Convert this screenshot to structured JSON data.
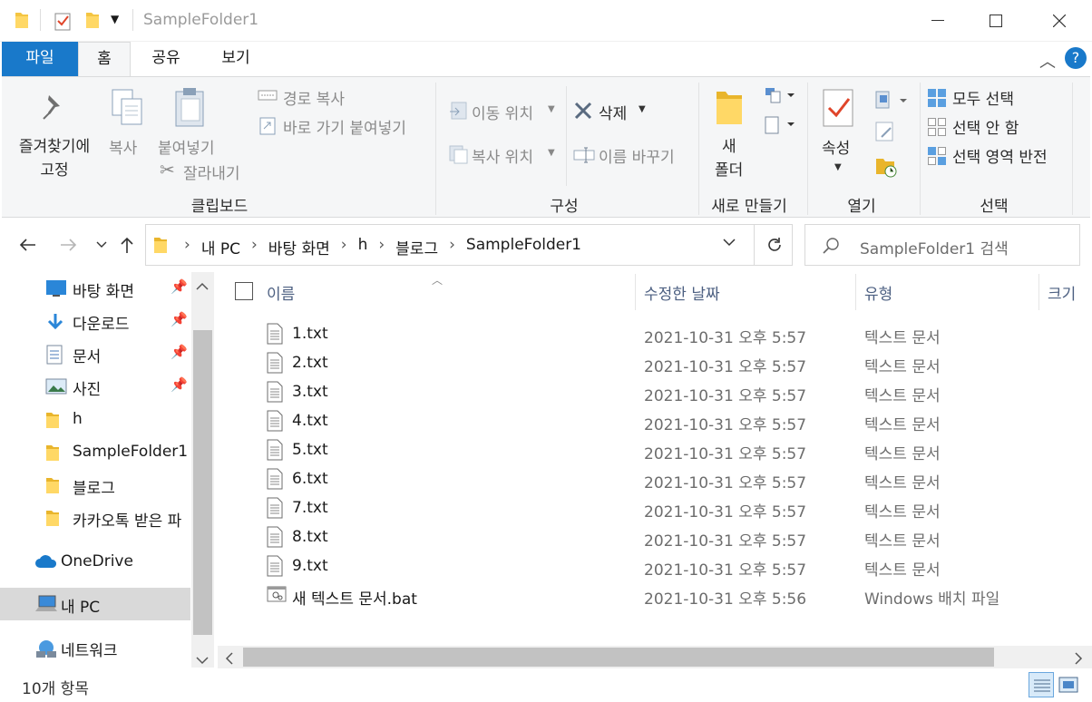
{
  "window": {
    "title": "SampleFolder1"
  },
  "tabs": {
    "file": "파일",
    "home": "홈",
    "share": "공유",
    "view": "보기"
  },
  "ribbon": {
    "clipboard": {
      "pin_quick_access": "즐겨찾기에 고정",
      "copy": "복사",
      "paste": "붙여넣기",
      "copy_path": "경로 복사",
      "paste_shortcut": "바로 가기 붙여넣기",
      "cut": "잘라내기",
      "group_label": "클립보드"
    },
    "organize": {
      "move_to": "이동 위치",
      "copy_to": "복사 위치",
      "delete": "삭제",
      "rename": "이름 바꾸기",
      "group_label": "구성"
    },
    "new": {
      "new_folder_line1": "새",
      "new_folder_line2": "폴더",
      "group_label": "새로 만들기"
    },
    "open": {
      "properties": "속성",
      "group_label": "열기"
    },
    "select": {
      "select_all": "모두 선택",
      "select_none": "선택 안 함",
      "invert_selection": "선택 영역 반전",
      "group_label": "선택"
    }
  },
  "address": {
    "crumbs": [
      "내 PC",
      "바탕 화면",
      "h",
      "블로그",
      "SampleFolder1"
    ],
    "search_placeholder": "SampleFolder1 검색"
  },
  "nav_pane": {
    "quick_access": [
      {
        "label": "바탕 화면",
        "icon": "desktop-icon",
        "pinned": true
      },
      {
        "label": "다운로드",
        "icon": "download-icon",
        "pinned": true
      },
      {
        "label": "문서",
        "icon": "documents-icon",
        "pinned": true
      },
      {
        "label": "사진",
        "icon": "pictures-icon",
        "pinned": true
      },
      {
        "label": "h",
        "icon": "folder-icon",
        "pinned": false
      },
      {
        "label": "SampleFolder1",
        "icon": "folder-icon",
        "pinned": false
      },
      {
        "label": "블로그",
        "icon": "folder-icon",
        "pinned": false
      },
      {
        "label": "카카오톡 받은 파",
        "icon": "folder-icon",
        "pinned": false
      }
    ],
    "onedrive": "OneDrive",
    "this_pc": "내 PC",
    "network": "네트워크"
  },
  "columns": {
    "name": "이름",
    "date": "수정한 날짜",
    "type": "유형",
    "size": "크기"
  },
  "files": [
    {
      "name": "1.txt",
      "date": "2021-10-31 오후 5:57",
      "type": "텍스트 문서",
      "icon": "text-file-icon"
    },
    {
      "name": "2.txt",
      "date": "2021-10-31 오후 5:57",
      "type": "텍스트 문서",
      "icon": "text-file-icon"
    },
    {
      "name": "3.txt",
      "date": "2021-10-31 오후 5:57",
      "type": "텍스트 문서",
      "icon": "text-file-icon"
    },
    {
      "name": "4.txt",
      "date": "2021-10-31 오후 5:57",
      "type": "텍스트 문서",
      "icon": "text-file-icon"
    },
    {
      "name": "5.txt",
      "date": "2021-10-31 오후 5:57",
      "type": "텍스트 문서",
      "icon": "text-file-icon"
    },
    {
      "name": "6.txt",
      "date": "2021-10-31 오후 5:57",
      "type": "텍스트 문서",
      "icon": "text-file-icon"
    },
    {
      "name": "7.txt",
      "date": "2021-10-31 오후 5:57",
      "type": "텍스트 문서",
      "icon": "text-file-icon"
    },
    {
      "name": "8.txt",
      "date": "2021-10-31 오후 5:57",
      "type": "텍스트 문서",
      "icon": "text-file-icon"
    },
    {
      "name": "9.txt",
      "date": "2021-10-31 오후 5:57",
      "type": "텍스트 문서",
      "icon": "text-file-icon"
    },
    {
      "name": "새 텍스트 문서.bat",
      "date": "2021-10-31 오후 5:56",
      "type": "Windows 배치 파일",
      "icon": "batch-file-icon"
    }
  ],
  "status": {
    "item_count": "10개 항목"
  },
  "colors": {
    "accent": "#1979ca",
    "ribbon_bg": "#f5f6f7",
    "folder": "#f4c542",
    "header_text": "#4d6082"
  }
}
